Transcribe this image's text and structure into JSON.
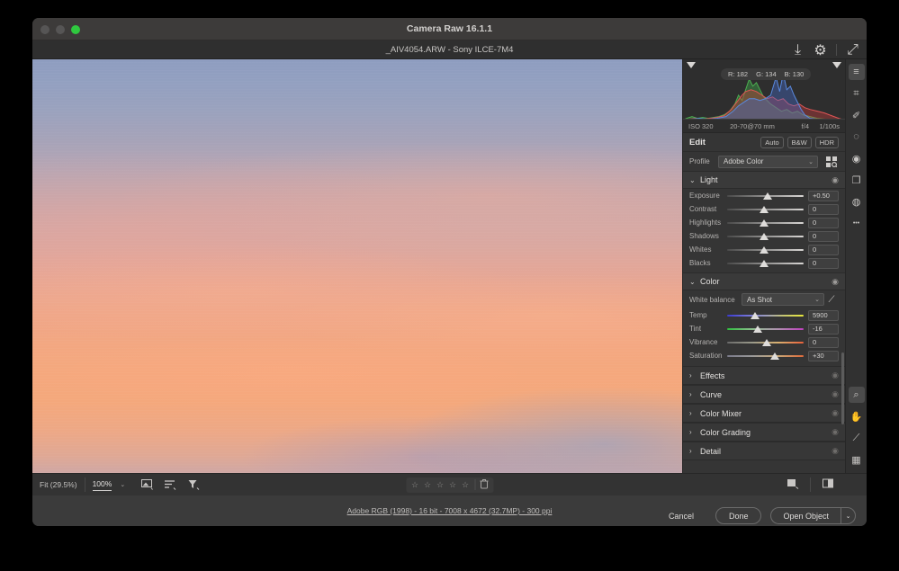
{
  "window": {
    "title": "Camera Raw 16.1.1",
    "filename": "_AIV4054.ARW  -  Sony ILCE-7M4"
  },
  "header_icons": [
    {
      "name": "save-image-icon",
      "glyph": "⤓"
    },
    {
      "name": "preferences-gear-icon",
      "glyph": "⚙"
    },
    {
      "name": "fullscreen-icon",
      "glyph": "⤢"
    }
  ],
  "histogram": {
    "readout": {
      "r": "R: 182",
      "g": "G: 134",
      "b": "B: 130"
    },
    "exif": {
      "iso": "ISO 320",
      "lens": "20-70@70 mm",
      "aperture": "f/4",
      "shutter": "1/100s"
    }
  },
  "edit": {
    "title": "Edit",
    "modes": [
      "Auto",
      "B&W",
      "HDR"
    ],
    "profile_label": "Profile",
    "profile_value": "Adobe Color"
  },
  "light": {
    "title": "Light",
    "sliders": [
      {
        "label": "Exposure",
        "value": "+0.50",
        "pos": 53
      },
      {
        "label": "Contrast",
        "value": "0",
        "pos": 48
      },
      {
        "label": "Highlights",
        "value": "0",
        "pos": 48
      },
      {
        "label": "Shadows",
        "value": "0",
        "pos": 48
      },
      {
        "label": "Whites",
        "value": "0",
        "pos": 48
      },
      {
        "label": "Blacks",
        "value": "0",
        "pos": 48
      }
    ]
  },
  "color": {
    "title": "Color",
    "wb_label": "White balance",
    "wb_value": "As Shot",
    "sliders": [
      {
        "label": "Temp",
        "value": "5900",
        "pos": 36,
        "grad": "linear-gradient(90deg,#3a3ad0,#6f6fd8,#9b9bbf,#c8c870,#e8e83a)"
      },
      {
        "label": "Tint",
        "value": "-16",
        "pos": 40,
        "grad": "linear-gradient(90deg,#2fbf3f,#8fbf8f,#b08fb0,#c040c0)"
      },
      {
        "label": "Vibrance",
        "value": "0",
        "pos": 52,
        "grad": "linear-gradient(90deg,#6a6a6a,#9a9a8a,#d8b070,#e8603a)"
      },
      {
        "label": "Saturation",
        "value": "+30",
        "pos": 62,
        "grad": "linear-gradient(90deg,#7a7a8a,#9a9a9a,#c8a878,#e06a3a)"
      }
    ]
  },
  "collapsed_sections": [
    {
      "label": "Effects"
    },
    {
      "label": "Curve"
    },
    {
      "label": "Color Mixer"
    },
    {
      "label": "Color Grading"
    },
    {
      "label": "Detail"
    }
  ],
  "tools_top": [
    {
      "name": "edit-sliders-tool",
      "glyph": "≡",
      "active": true
    },
    {
      "name": "crop-tool",
      "glyph": "⌗",
      "active": false
    },
    {
      "name": "healing-brush-tool",
      "glyph": "✐",
      "active": false
    },
    {
      "name": "masking-tool",
      "glyph": "◌",
      "active": false
    },
    {
      "name": "red-eye-tool",
      "glyph": "◉",
      "active": false
    },
    {
      "name": "presets-tool",
      "glyph": "❐",
      "active": false
    },
    {
      "name": "snapshots-tool",
      "glyph": "◍",
      "active": false
    },
    {
      "name": "more-options-tool",
      "glyph": "•••",
      "active": false
    }
  ],
  "tools_bottom": [
    {
      "name": "zoom-tool",
      "glyph": "⌕",
      "active": true
    },
    {
      "name": "hand-tool",
      "glyph": "✋",
      "active": false
    },
    {
      "name": "eyedropper-tool",
      "glyph": "⟋",
      "active": false
    },
    {
      "name": "grid-overlay-tool",
      "glyph": "▦",
      "active": false
    }
  ],
  "bottombar": {
    "fit_label": "Fit (29.5%)",
    "zoom_value": "100%",
    "zoom_chevron": "⌄",
    "tools": [
      {
        "name": "toggle-overlay-icon",
        "glyph": "▣"
      },
      {
        "name": "filmstrip-sort-icon",
        "glyph": "≡"
      },
      {
        "name": "filter-icon",
        "glyph": "▽"
      }
    ],
    "stars": [
      "☆",
      "☆",
      "☆",
      "☆",
      "☆"
    ],
    "trash": "🗑",
    "right_tools": [
      {
        "name": "fullscreen-preview-icon",
        "glyph": "◨"
      },
      {
        "name": "before-after-icon",
        "glyph": "◫"
      }
    ]
  },
  "footer": {
    "workflow_link": "Adobe RGB (1998) - 16 bit - 7008 x 4672 (32.7MP) - 300 ppi",
    "cancel": "Cancel",
    "done": "Done",
    "open_object": "Open Object",
    "open_caret": "⌄"
  }
}
